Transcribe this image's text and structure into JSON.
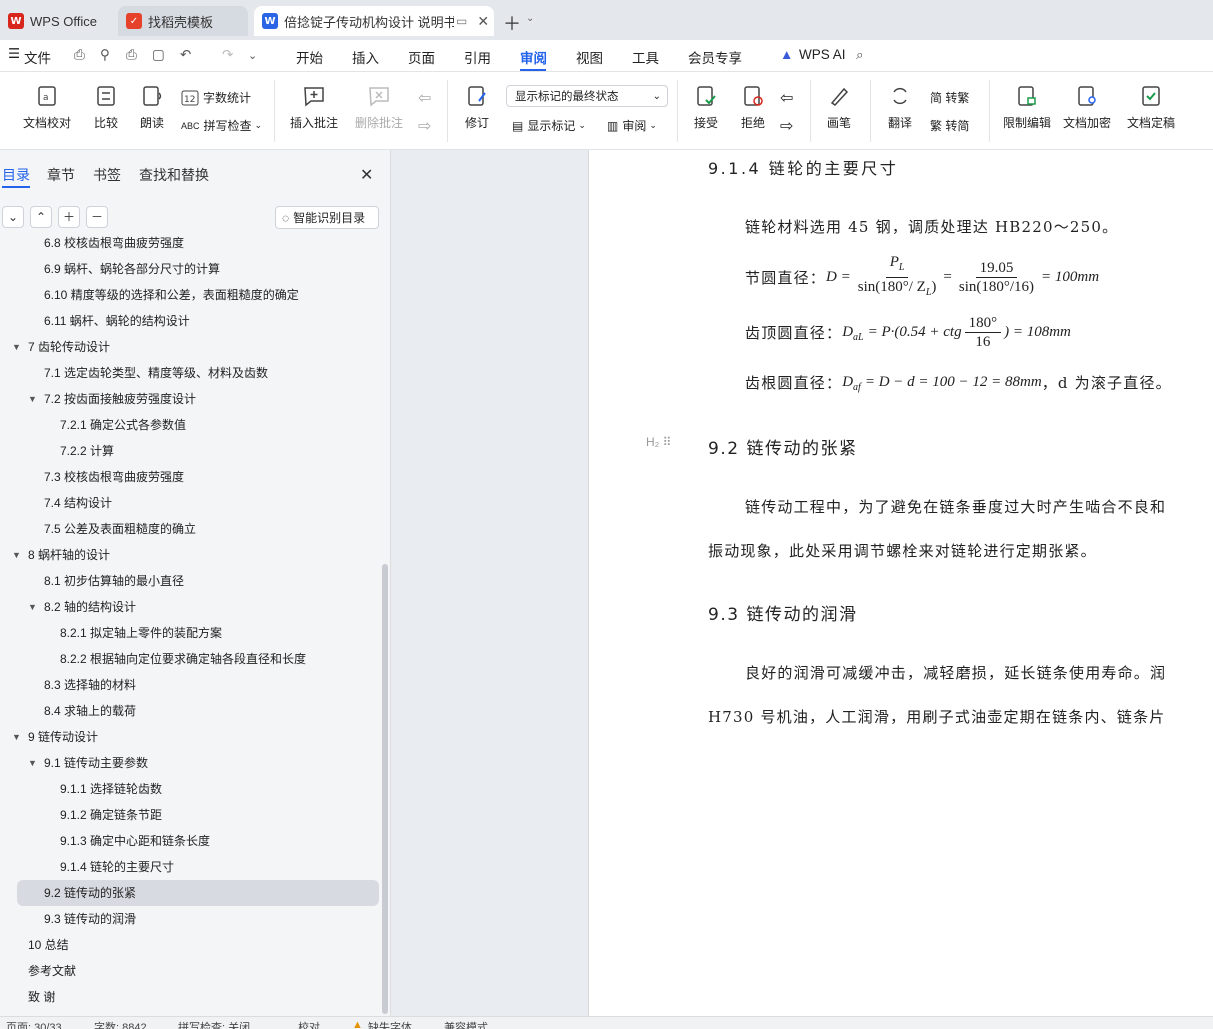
{
  "tabs": {
    "wps": "WPS Office",
    "template": "找稻壳模板",
    "doc": "倍捻锭子传动机构设计 说明书"
  },
  "menubar": {
    "file": "文件",
    "items": [
      "开始",
      "插入",
      "页面",
      "引用",
      "审阅",
      "视图",
      "工具",
      "会员专享"
    ],
    "active": "审阅",
    "ai": "WPS AI"
  },
  "ribbon": {
    "proofread": "文档校对",
    "compare": "比较",
    "read_aloud": "朗读",
    "word_count": "字数统计",
    "spell_check": "拼写检查",
    "insert_comment": "插入批注",
    "delete_comment": "删除批注",
    "track_changes": "修订",
    "markup_select": "显示标记的最终状态",
    "show_markup": "显示标记",
    "review": "审阅",
    "accept": "接受",
    "reject": "拒绝",
    "pen": "画笔",
    "translate": "翻译",
    "to_traditional": "简 转繁",
    "to_simplified": "繁 转简",
    "restrict_edit": "限制编辑",
    "encrypt": "文档加密",
    "finalize": "文档定稿"
  },
  "nav": {
    "tabs": [
      "目录",
      "章节",
      "书签",
      "查找和替换"
    ],
    "active_tab": "目录",
    "smart_toc": "智能识别目录",
    "toc": [
      {
        "label": "6.8 校核齿根弯曲疲劳强度",
        "level": 2,
        "caret": ""
      },
      {
        "label": "6.9 蜗杆、蜗轮各部分尺寸的计算",
        "level": 2,
        "caret": ""
      },
      {
        "label": "6.10 精度等级的选择和公差，表面粗糙度的确定",
        "level": 2,
        "caret": ""
      },
      {
        "label": "6.11 蜗杆、蜗轮的结构设计",
        "level": 2,
        "caret": ""
      },
      {
        "label": "7 齿轮传动设计",
        "level": 1,
        "caret": "▼"
      },
      {
        "label": "7.1 选定齿轮类型、精度等级、材料及齿数",
        "level": 2,
        "caret": ""
      },
      {
        "label": "7.2 按齿面接触疲劳强度设计",
        "level": 2,
        "caret": "▼"
      },
      {
        "label": "7.2.1 确定公式各参数值",
        "level": 3,
        "caret": ""
      },
      {
        "label": "7.2.2 计算",
        "level": 3,
        "caret": ""
      },
      {
        "label": "7.3 校核齿根弯曲疲劳强度",
        "level": 2,
        "caret": ""
      },
      {
        "label": "7.4 结构设计",
        "level": 2,
        "caret": ""
      },
      {
        "label": "7.5 公差及表面粗糙度的确立",
        "level": 2,
        "caret": ""
      },
      {
        "label": "8 蜗杆轴的设计",
        "level": 1,
        "caret": "▼"
      },
      {
        "label": "8.1 初步估算轴的最小直径",
        "level": 2,
        "caret": ""
      },
      {
        "label": "8.2 轴的结构设计",
        "level": 2,
        "caret": "▼"
      },
      {
        "label": "8.2.1 拟定轴上零件的装配方案",
        "level": 3,
        "caret": ""
      },
      {
        "label": "8.2.2 根据轴向定位要求确定轴各段直径和长度",
        "level": 3,
        "caret": ""
      },
      {
        "label": "8.3 选择轴的材料",
        "level": 2,
        "caret": ""
      },
      {
        "label": "8.4 求轴上的载荷",
        "level": 2,
        "caret": ""
      },
      {
        "label": "9 链传动设计",
        "level": 1,
        "caret": "▼"
      },
      {
        "label": "9.1 链传动主要参数",
        "level": 2,
        "caret": "▼"
      },
      {
        "label": "9.1.1 选择链轮齿数",
        "level": 3,
        "caret": ""
      },
      {
        "label": "9.1.2 确定链条节距",
        "level": 3,
        "caret": ""
      },
      {
        "label": "9.1.3 确定中心距和链条长度",
        "level": 3,
        "caret": ""
      },
      {
        "label": "9.1.4 链轮的主要尺寸",
        "level": 3,
        "caret": ""
      },
      {
        "label": "9.2 链传动的张紧",
        "level": 2,
        "caret": "",
        "selected": true
      },
      {
        "label": "9.3 链传动的润滑",
        "level": 2,
        "caret": ""
      },
      {
        "label": "10 总结",
        "level": 1,
        "caret": ""
      },
      {
        "label": "参考文献",
        "level": 1,
        "caret": ""
      },
      {
        "label": "致 谢",
        "level": 1,
        "caret": ""
      }
    ]
  },
  "doc": {
    "h914": "9.1.4 链轮的主要尺寸",
    "p_material": "链轮材料选用 45 钢，调质处理达 HB220～250。",
    "pitch_label": "节圆直径：",
    "pitch_eq": {
      "lhs": "D =",
      "f1_num": "P",
      "f1_num_sub": "L",
      "f1_den": "sin(180°/ Z",
      "f1_den_sub": "L",
      "f1_den_end": ")",
      "eq2": "=",
      "f2_num": "19.05",
      "f2_den": "sin(180°/16)",
      "result": "= 100mm"
    },
    "tip_label": "齿顶圆直径：",
    "tip_eq": {
      "lhs": "D",
      "lhs_sub": "aL",
      "mid": "= P·(0.54 + ctg",
      "f_num": "180°",
      "f_den": "16",
      "result": ") = 108mm"
    },
    "root_label": "齿根圆直径：",
    "root_eq": {
      "lhs": "D",
      "lhs_sub": "af",
      "mid": "= D − d = 100 − 12 = 88mm",
      "tail": "，d 为滚子直径。"
    },
    "h92": "9.2 链传动的张紧",
    "h2_marker": "H₂",
    "p92_1": "链传动工程中，为了避免在链条垂度过大时产生啮合不良和",
    "p92_2": "振动现象，此处采用调节螺栓来对链轮进行定期张紧。",
    "h93": "9.3 链传动的润滑",
    "p93_1": "良好的润滑可减缓冲击，减轻磨损，延长链条使用寿命。润",
    "p93_2": "H730 号机油，人工润滑，用刷子式油壶定期在链条内、链条片"
  },
  "status": {
    "page": "页面: 30/33",
    "words": "字数: 8842",
    "spell": "拼写检查: 关闭",
    "proof": "校对",
    "missing_font": "缺失字体",
    "compat": "兼容模式"
  },
  "colors": {
    "accent": "#2463eb",
    "selected_row": "#d7dbe1"
  }
}
